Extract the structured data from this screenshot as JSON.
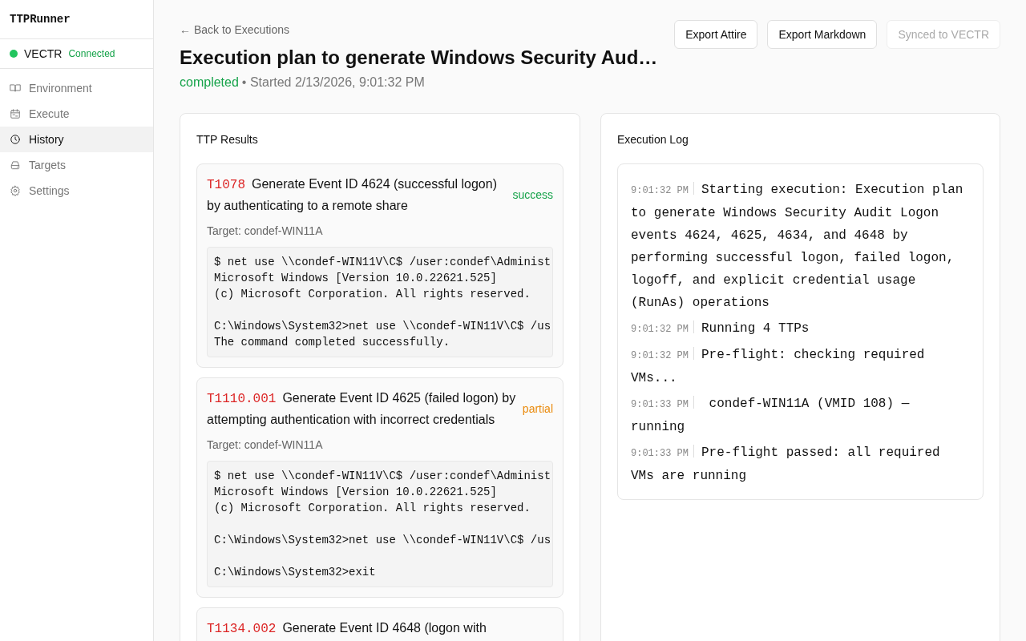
{
  "sidebar": {
    "app_name": "TTPRunner",
    "connection": {
      "name": "VECTR",
      "status": "Connected",
      "connected": true
    },
    "items": [
      {
        "label": "Environment",
        "selected": false
      },
      {
        "label": "Execute",
        "selected": false
      },
      {
        "label": "History",
        "selected": true
      },
      {
        "label": "Targets",
        "selected": false
      },
      {
        "label": "Settings",
        "selected": false
      }
    ]
  },
  "header": {
    "back_link": "← Back to Executions",
    "title": "Execution plan to generate Windows Security Aud…",
    "status": "completed",
    "started": "• Started 2/13/2026, 9:01:32 PM",
    "buttons": [
      {
        "label": "Export Attire",
        "disabled": false
      },
      {
        "label": "Export Markdown",
        "disabled": false
      },
      {
        "label": "Synced to VECTR",
        "disabled": true
      }
    ]
  },
  "results": {
    "title": "TTP Results",
    "items": [
      {
        "id": "T1078",
        "name": "Generate Event ID 4624 (successful logon) by authenticating to a remote share",
        "status": "success",
        "color": "#16a34a",
        "target": "Target: condef-WIN11A",
        "output": "$ net use \\\\condef-WIN11V\\C$ /user:condef\\Administ\nMicrosoft Windows [Version 10.0.22621.525]\n(c) Microsoft Corporation. All rights reserved.\n\nC:\\Windows\\System32>net use \\\\condef-WIN11V\\C$ /us\nThe command completed successfully.\n"
      },
      {
        "id": "T1110.001",
        "name": "Generate Event ID 4625 (failed logon) by attempting authentication with incorrect credentials",
        "status": "partial",
        "color": "#ea8a0c",
        "target": "Target: condef-WIN11A",
        "output": "$ net use \\\\condef-WIN11V\\C$ /user:condef\\Administ\nMicrosoft Windows [Version 10.0.22621.525]\n(c) Microsoft Corporation. All rights reserved.\n\nC:\\Windows\\System32>net use \\\\condef-WIN11V\\C$ /us\n\nC:\\Windows\\System32>exit"
      },
      {
        "id": "T1134.002",
        "name": "Generate Event ID 4648 (logon with"
      }
    ]
  },
  "log": {
    "title": "Execution Log",
    "entries": [
      {
        "time": "9:01:32 PM",
        "message": "Starting execution: Execution plan to generate Windows Security Audit Logon events 4624, 4625, 4634, and 4648 by performing successful logon, failed logon, logoff, and explicit credential usage (RunAs) operations"
      },
      {
        "time": "9:01:32 PM",
        "message": "Running 4 TTPs"
      },
      {
        "time": "9:01:32 PM",
        "message": "Pre-flight: checking required VMs..."
      },
      {
        "time": "9:01:33 PM",
        "message": " condef-WIN11A (VMID 108) — running"
      },
      {
        "time": "9:01:33 PM",
        "message": "Pre-flight passed: all required VMs are running"
      }
    ]
  }
}
